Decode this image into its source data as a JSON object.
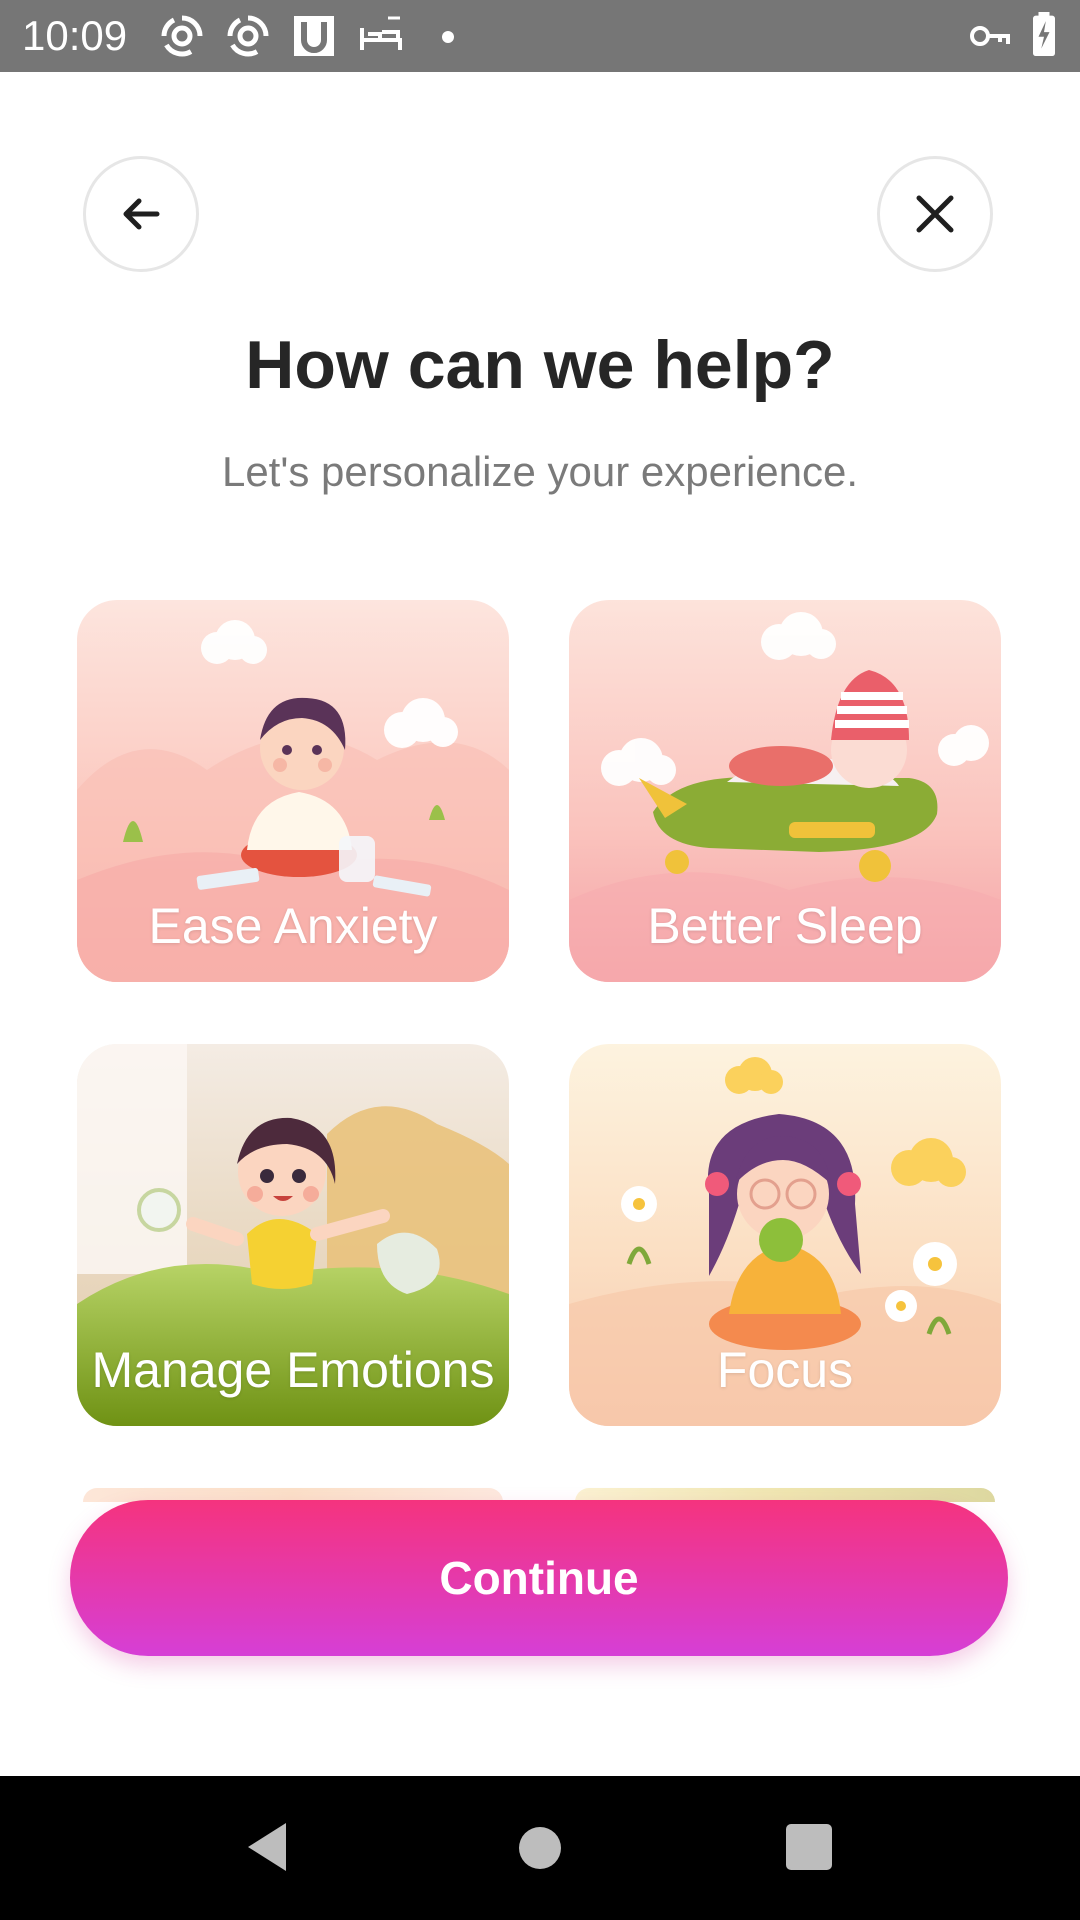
{
  "status_bar": {
    "time": "10:09",
    "icons": [
      "swirl-app-icon",
      "swirl-app-icon",
      "u-app-icon",
      "bed-icon",
      "dot-icon",
      "vpn-key-icon",
      "battery-charging-icon"
    ]
  },
  "header": {
    "back_icon": "arrow-left-icon",
    "close_icon": "close-icon",
    "title": "How can we help?",
    "subtitle": "Let's personalize your experience."
  },
  "options": [
    {
      "label": "Ease Anxiety",
      "illustration": "child-meditating-illustration"
    },
    {
      "label": "Better Sleep",
      "illustration": "baby-sleeping-on-plane-illustration"
    },
    {
      "label": "Manage Emotions",
      "illustration": "child-waking-in-bed-illustration"
    },
    {
      "label": "Focus",
      "illustration": "girl-eating-apple-illustration"
    }
  ],
  "continue_label": "Continue",
  "colors": {
    "accent_top": "#f5337e",
    "accent_bottom": "#d63fd6",
    "title": "#262626",
    "subtitle": "#7a7a7a"
  },
  "nav_bar": {
    "icons": [
      "nav-back-icon",
      "nav-home-icon",
      "nav-recents-icon"
    ]
  }
}
